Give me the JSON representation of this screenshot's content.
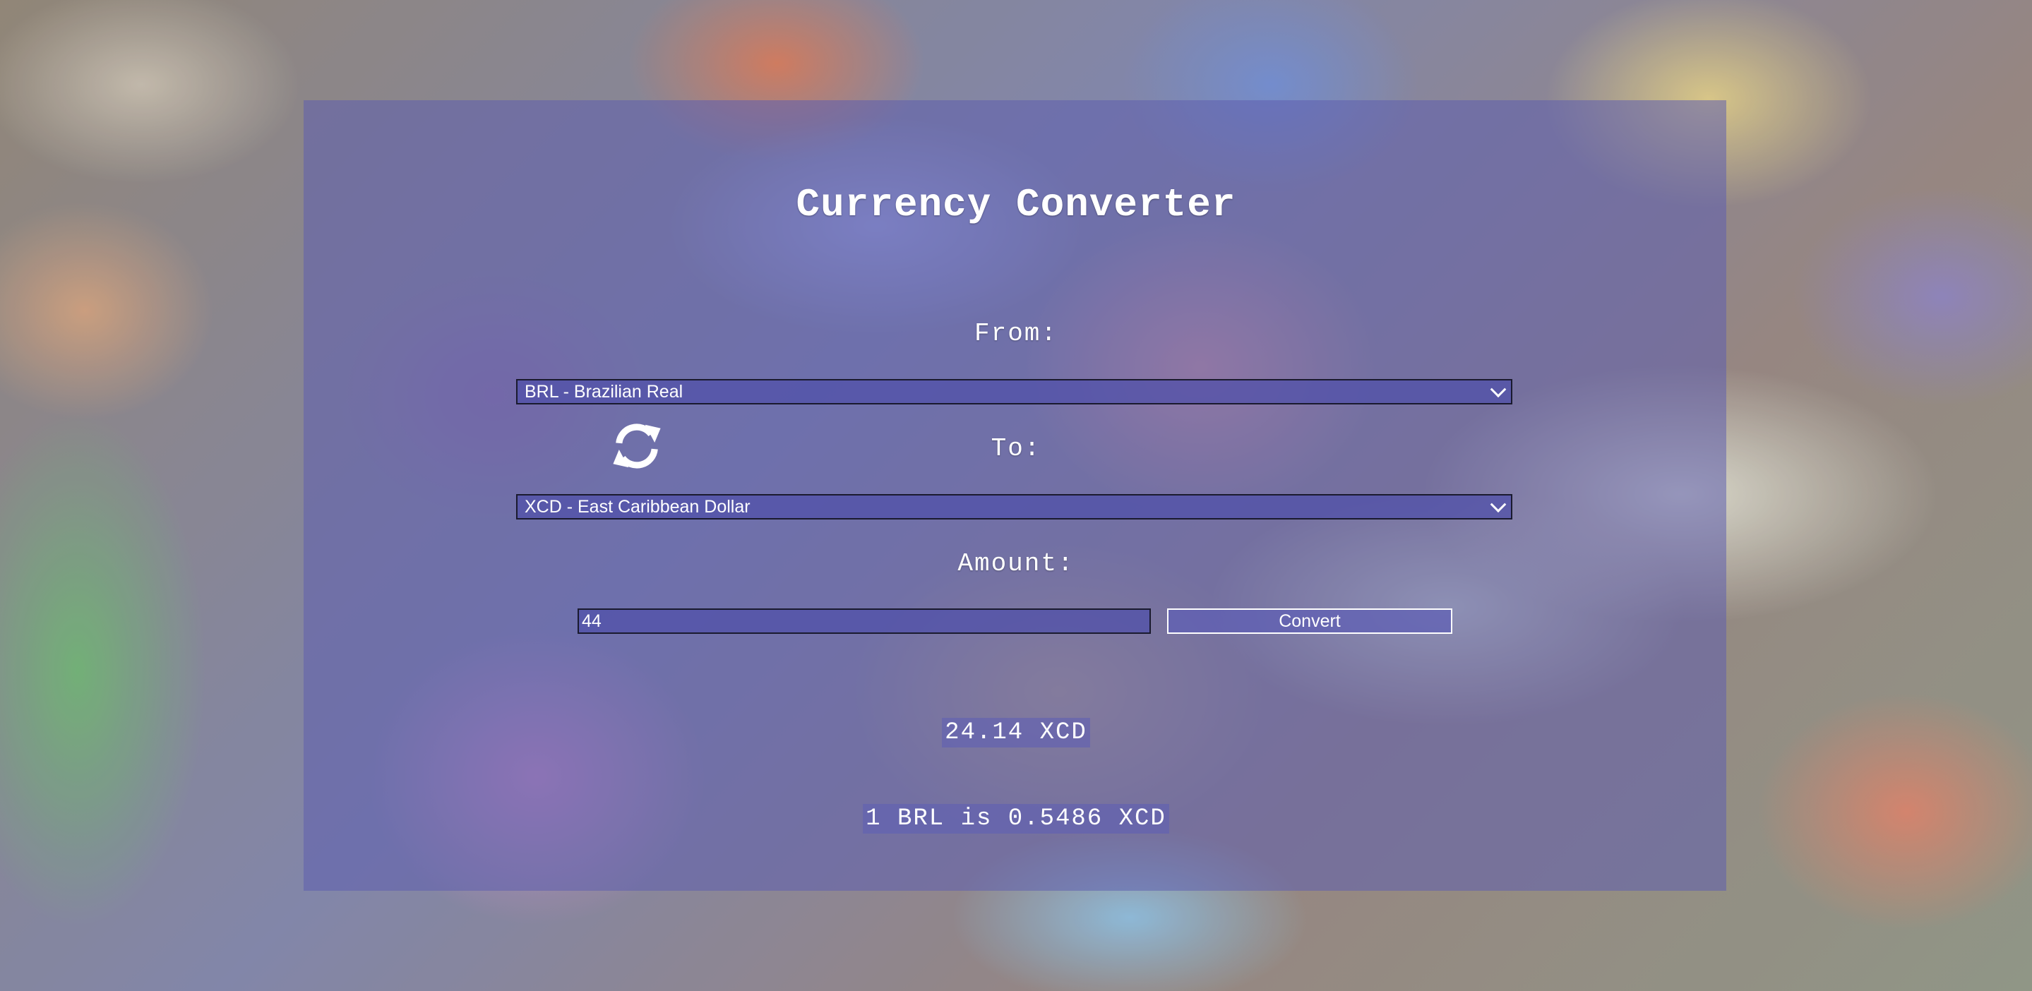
{
  "page": {
    "title": "Currency Converter"
  },
  "form": {
    "from_label": "From:",
    "to_label": "To:",
    "amount_label": "Amount:",
    "from_currency": "BRL - Brazilian Real",
    "to_currency": "XCD - East Caribbean Dollar",
    "amount_value": "44",
    "convert_label": "Convert"
  },
  "result": {
    "converted": "24.14 XCD",
    "rate": "1 BRL is 0.5486 XCD"
  },
  "icons": {
    "swap": "swap-arrows-icon",
    "dropdown": "chevron-down-icon"
  },
  "colors": {
    "panel": "#5f5faf",
    "text": "#ffffff"
  }
}
